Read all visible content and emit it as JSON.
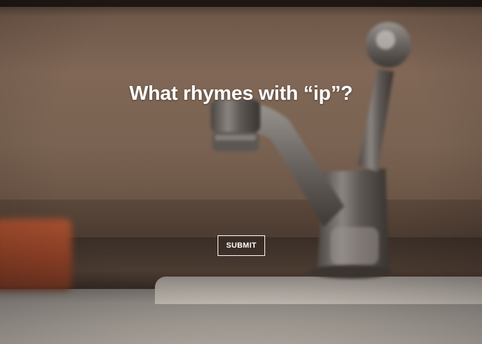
{
  "quiz": {
    "question": "What rhymes with “ip”?",
    "submit_label": "SUBMIT"
  },
  "background": {
    "scene": "blurred kitchen faucet photo"
  }
}
